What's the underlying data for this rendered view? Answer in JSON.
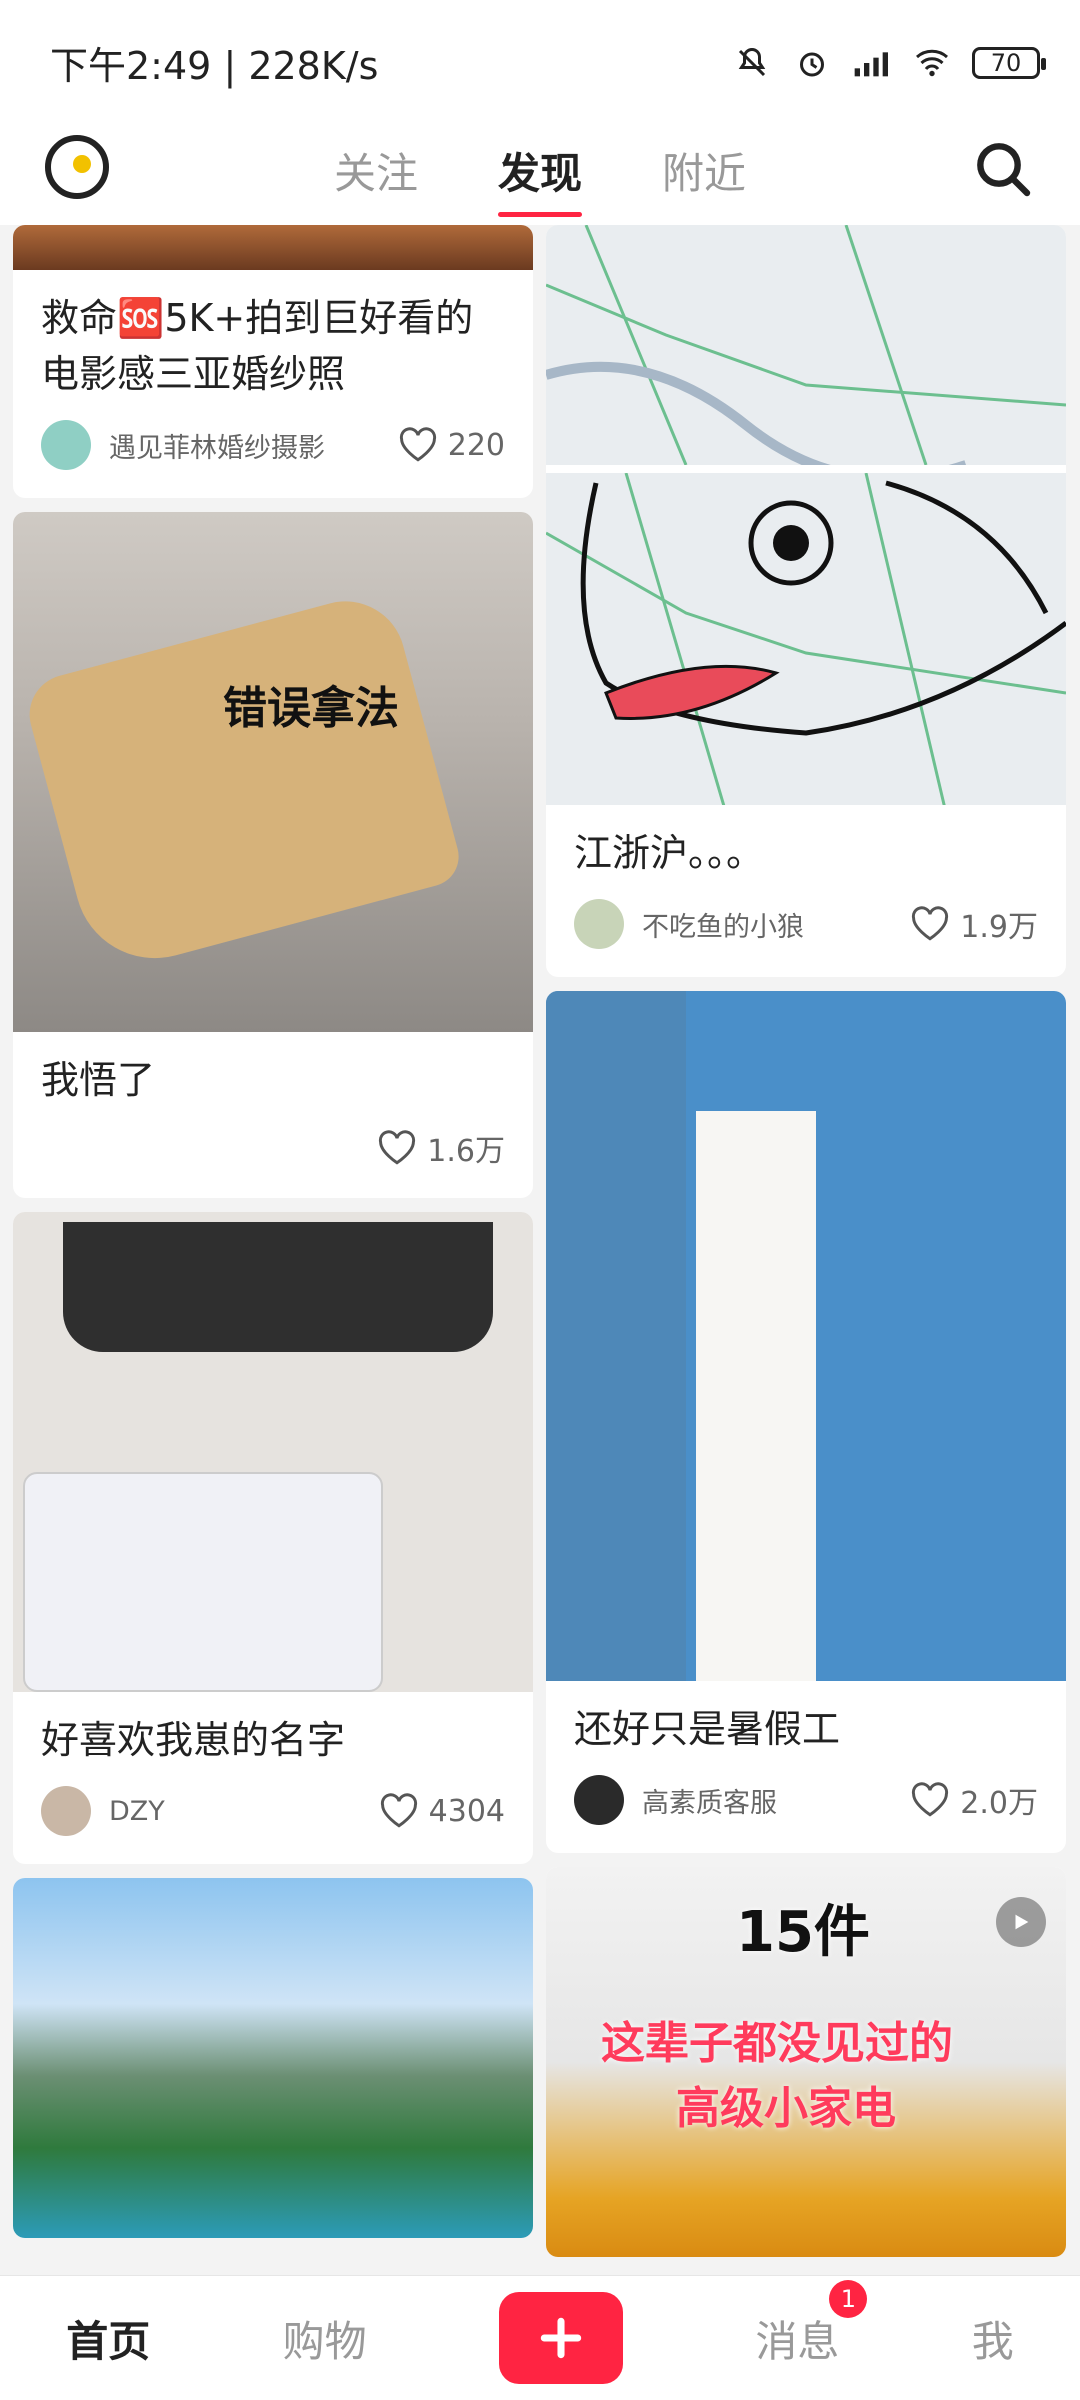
{
  "status_bar": {
    "time": "下午2:49",
    "speed": "228K/s",
    "battery": "70"
  },
  "top_nav": {
    "tabs": [
      "关注",
      "发现",
      "附近"
    ],
    "active_tab": "发现"
  },
  "feed": {
    "left": [
      {
        "title": "救命🆘5K+拍到巨好看的电影感三亚婚纱照",
        "author": "遇见菲林婚纱摄影",
        "likes": "220"
      },
      {
        "overlay_text": "错误拿法",
        "title": "我悟了",
        "author": "",
        "likes": "1.6万"
      },
      {
        "title": "好喜欢我崽的名字",
        "author": "DZY",
        "likes": "4304"
      },
      {
        "title": "",
        "author": "",
        "likes": ""
      }
    ],
    "right": [
      {
        "title": "江浙沪。。。",
        "author": "不吃鱼的小狼",
        "likes": "1.9万"
      },
      {
        "title": "还好只是暑假工",
        "author": "高素质客服",
        "likes": "2.0万"
      },
      {
        "overlay_text_1": "15件",
        "overlay_text_2": "这辈子都没见过的",
        "overlay_text_3": "高级小家电",
        "title": "",
        "author": "",
        "likes": ""
      }
    ]
  },
  "bottom_nav": {
    "items": [
      "首页",
      "购物",
      "消息",
      "我"
    ],
    "active": "首页",
    "messages_badge": "1"
  },
  "colors": {
    "accent": "#ff2442",
    "text": "#222222"
  }
}
